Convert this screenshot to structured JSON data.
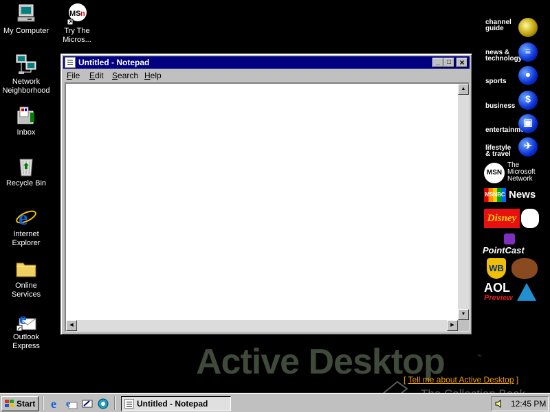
{
  "desktop": {
    "icons": [
      {
        "label1": "My Computer",
        "label2": ""
      },
      {
        "label1": "Try The",
        "label2": "Micros..."
      },
      {
        "label1": "Network",
        "label2": "Neighborhood"
      },
      {
        "label1": "Inbox",
        "label2": ""
      },
      {
        "label1": "Recycle Bin",
        "label2": ""
      },
      {
        "label1": "Internet",
        "label2": "Explorer"
      },
      {
        "label1": "Online",
        "label2": "Services"
      },
      {
        "label1": "Outlook",
        "label2": "Express"
      }
    ]
  },
  "channels": {
    "items": [
      {
        "line1": "channel",
        "line2": "guide"
      },
      {
        "line1": "news &",
        "line2": "technology"
      },
      {
        "line1": "sports",
        "line2": ""
      },
      {
        "line1": "business",
        "line2": ""
      },
      {
        "line1": "entertainment",
        "line2": ""
      },
      {
        "line1": "lifestyle",
        "line2": "& travel"
      }
    ],
    "msn": {
      "badge": "MSN",
      "line1": "The",
      "line2": "Microsoft",
      "line3": "Network"
    },
    "msnbc": {
      "badge": "MSNBC",
      "text": "News"
    },
    "disney": "Disney",
    "pointcast": "PointCast",
    "wb": "WB",
    "aol": {
      "line1": "AOL",
      "line2": "Preview"
    }
  },
  "watermark": {
    "title": "Active Desktop",
    "tm": "™",
    "tell_open": "[ ",
    "tell_link": "Tell me about Active Desktop",
    "tell_close": " ]",
    "collection": "The Collection Book"
  },
  "notepad": {
    "title": "Untitled - Notepad",
    "controls": {
      "minimize": "_",
      "maximize": "□",
      "close": "×"
    },
    "menu": [
      {
        "key": "F",
        "rest": "ile"
      },
      {
        "key": "E",
        "rest": "dit"
      },
      {
        "key": "S",
        "rest": "earch"
      },
      {
        "key": "H",
        "rest": "elp"
      }
    ],
    "content": ""
  },
  "taskbar": {
    "start_label": "Start",
    "task_label": "Untitled - Notepad",
    "clock": "12:45 PM"
  },
  "colors": {
    "desktop": "#000000",
    "titlebar": "#000080",
    "face": "#c0c0c0",
    "link": "#f0a000"
  }
}
